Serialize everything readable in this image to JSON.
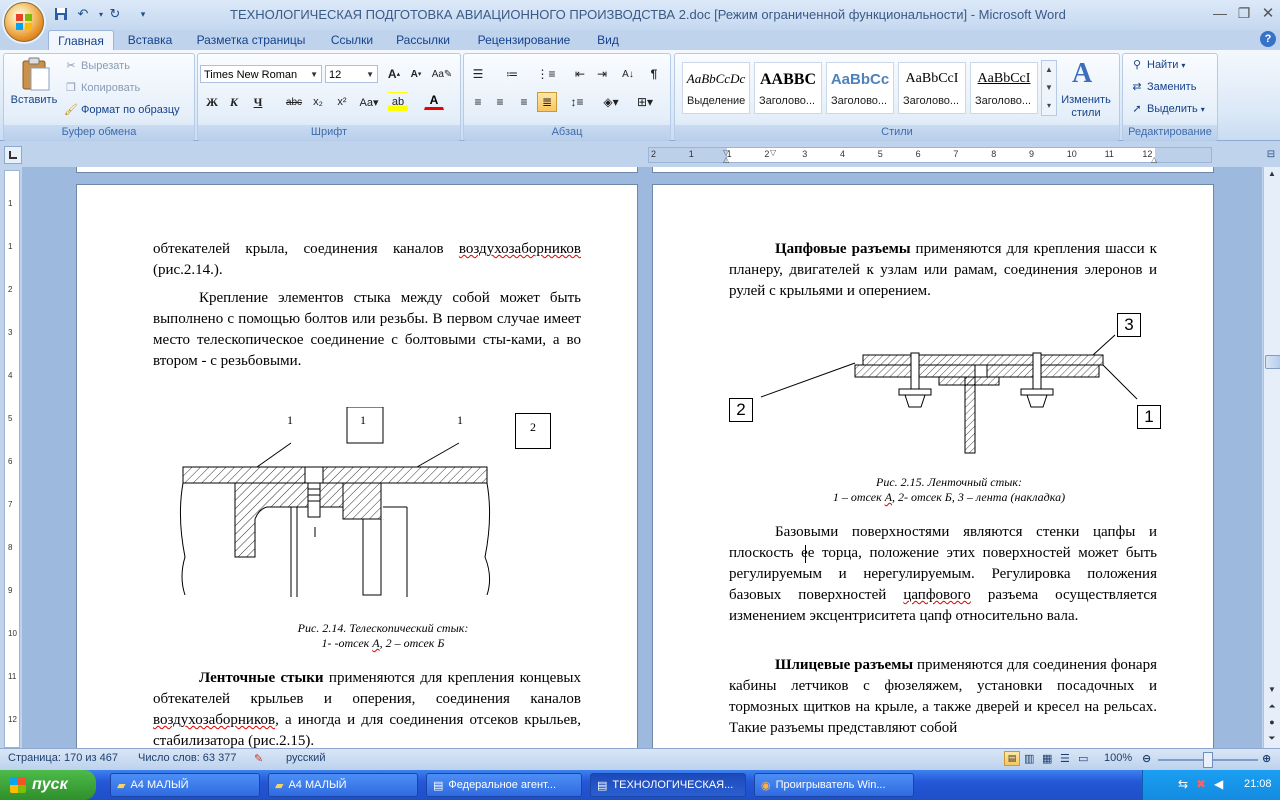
{
  "titlebar": {
    "title": "ТЕХНОЛОГИЧЕСКАЯ ПОДГОТОВКА АВИАЦИОННОГО ПРОИЗВОДСТВА 2.doc [Режим ограниченной функциональности] - Microsoft Word"
  },
  "tabs": [
    {
      "label": "Главная"
    },
    {
      "label": "Вставка"
    },
    {
      "label": "Разметка страницы"
    },
    {
      "label": "Ссылки"
    },
    {
      "label": "Рассылки"
    },
    {
      "label": "Рецензирование"
    },
    {
      "label": "Вид"
    }
  ],
  "ribbon": {
    "clipboard": {
      "label": "Буфер обмена",
      "paste": "Вставить",
      "cut": "Вырезать",
      "copy": "Копировать",
      "format_painter": "Формат по образцу"
    },
    "font": {
      "label": "Шрифт",
      "font_name": "Times New Roman",
      "font_size": "12"
    },
    "paragraph": {
      "label": "Абзац"
    },
    "styles": {
      "label": "Стили",
      "items": [
        {
          "sample": "AaBbCcDc",
          "name": "Выделение"
        },
        {
          "sample": "AABBC",
          "name": "Заголово..."
        },
        {
          "sample": "AaBbCc",
          "name": "Заголово..."
        },
        {
          "sample": "AaBbCcI",
          "name": "Заголово..."
        },
        {
          "sample": "AaBbCcI",
          "name": "Заголово..."
        }
      ],
      "change_styles": "Изменить стили"
    },
    "editing": {
      "label": "Редактирование",
      "find": "Найти",
      "replace": "Заменить",
      "select": "Выделить"
    }
  },
  "ruler": {
    "ticks": [
      "2",
      "1",
      "1",
      "2",
      "3",
      "4",
      "5",
      "6",
      "7",
      "8",
      "9",
      "10",
      "11",
      "12"
    ],
    "vticks": [
      "1",
      "1",
      "2",
      "3",
      "4",
      "5",
      "6",
      "7",
      "8",
      "9",
      "10",
      "11",
      "12",
      "13"
    ]
  },
  "left_page": {
    "para1_a": "обтекателей крыла, соединения каналов ",
    "para1_b": "воздухозаборников",
    "para1_c": " (рис.2.14.).",
    "para2": "Крепление элементов стыка между собой может быть выполнено с помощью болтов или резьбы. В первом случае имеет место телескопическое соединение с болтовыми сты-ками, а во втором - с резьбовыми.",
    "fig_labels": [
      "1",
      "1",
      "1",
      "2"
    ],
    "caption_1": "Рис. 2.14. Телескопический стык:",
    "caption_2a": "1- -отсек ",
    "caption_2b": "А",
    "caption_2c": ", 2 – отсек Б",
    "para3_bold": "Ленточные стыки",
    "para3_a": " применяются для крепления концевых обтекателей крыльев и оперения, соединения каналов ",
    "para3_b": "воздухозаборников",
    "para3_c": ", а иногда и для соединения отсеков крыльев, стабилизатора (рис.2.15)."
  },
  "right_page": {
    "para1_bold": "Цапфовые разъемы",
    "para1": " применяются для крепления шасси к планеру, двигателей к узлам или рамам, соединения элеронов и рулей с крыльями и оперением.",
    "fig_labels": [
      "3",
      "2",
      "1"
    ],
    "caption_1": "Рис. 2.15. Ленточный стык:",
    "caption_2a": "1 – отсек ",
    "caption_2b": "А",
    "caption_2c": ", 2- отсек Б, 3 – лента (накладка)",
    "para2_a": "Базовыми поверхностями являются стенки цапфы и плоскость ее торца, положение этих поверхностей может быть регулируемым и нерегулируемым. Регулировка положения базовых поверхностей ",
    "para2_b": "цапфового",
    "para2_c": " разъема осуществляется изменением эксцентриситета цапф относительно вала.",
    "para3_bold": "Шлицевые разъемы",
    "para3": " применяются для соединения фонаря кабины летчиков с фюзеляжем, установки посадочных и тормозных щитков на крыле, а также дверей и кресел на рельсах. Такие разъемы представляют собой"
  },
  "statusbar": {
    "page": "Страница: 170 из 467",
    "words": "Число слов: 63 377",
    "language": "русский",
    "zoom": "100%"
  },
  "taskbar": {
    "start": "пуск",
    "items": [
      {
        "label": "А4 МАЛЫЙ"
      },
      {
        "label": "А4 МАЛЫЙ"
      },
      {
        "label": "Федеральное агент..."
      },
      {
        "label": "ТЕХНОЛОГИЧЕСКАЯ..."
      },
      {
        "label": "Проигрыватель Win..."
      }
    ],
    "lang": "RU",
    "clock": "21:08"
  }
}
